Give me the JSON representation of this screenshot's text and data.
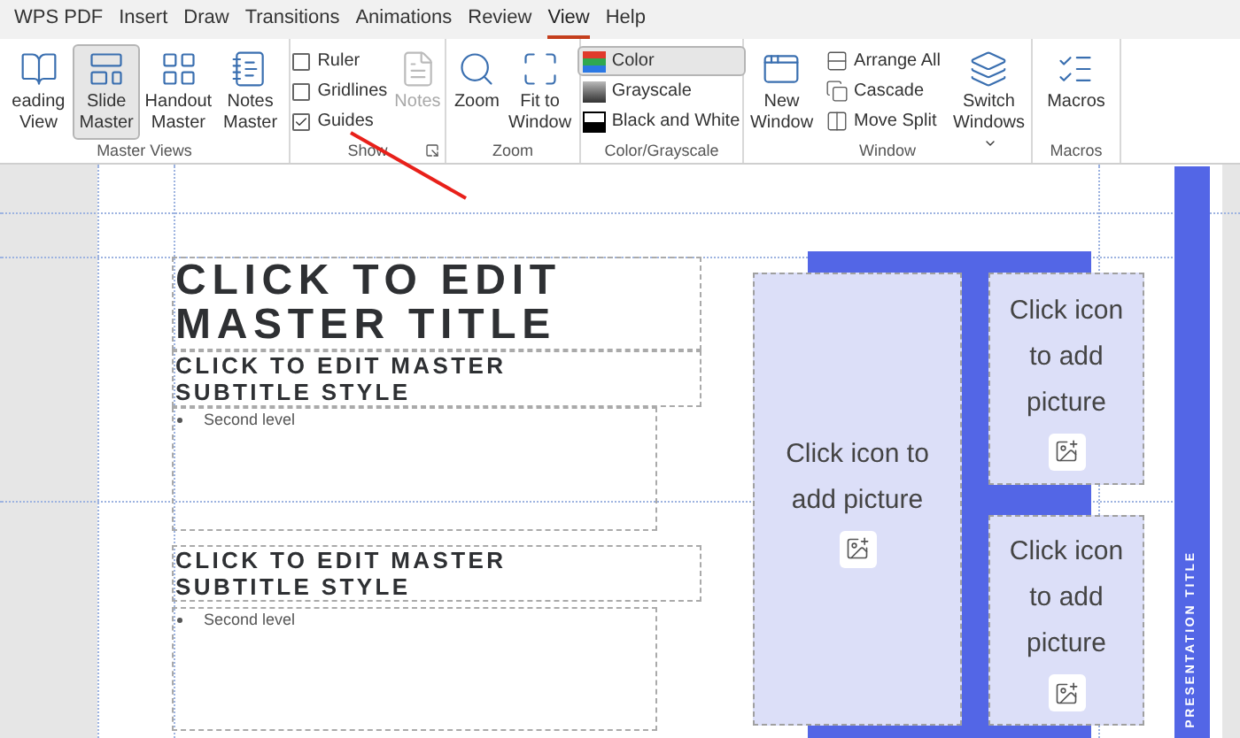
{
  "tabs": [
    {
      "label": "WPS PDF",
      "selected": false
    },
    {
      "label": "Insert",
      "selected": false
    },
    {
      "label": "Draw",
      "selected": false
    },
    {
      "label": "Transitions",
      "selected": false
    },
    {
      "label": "Animations",
      "selected": false
    },
    {
      "label": "Review",
      "selected": false
    },
    {
      "label": "View",
      "selected": true
    },
    {
      "label": "Help",
      "selected": false
    }
  ],
  "ribbon": {
    "groups": [
      {
        "label": "Master Views",
        "items": [
          {
            "kind": "large",
            "label": "eading View",
            "selected": false,
            "disabled": false
          },
          {
            "kind": "large",
            "label": "Slide Master",
            "selected": true,
            "disabled": false
          },
          {
            "kind": "large",
            "label": "Handout Master",
            "selected": false,
            "disabled": false
          },
          {
            "kind": "large",
            "label": "Notes Master",
            "selected": false,
            "disabled": false
          }
        ]
      },
      {
        "label": "Show",
        "launcher": true,
        "items": [
          {
            "kind": "check",
            "label": "Ruler",
            "checked": false
          },
          {
            "kind": "check",
            "label": "Gridlines",
            "checked": false
          },
          {
            "kind": "check",
            "label": "Guides",
            "checked": true
          },
          {
            "kind": "large",
            "label": "Notes",
            "selected": false,
            "disabled": true
          }
        ]
      },
      {
        "label": "Zoom",
        "items": [
          {
            "kind": "large",
            "label": "Zoom",
            "selected": false,
            "disabled": false
          },
          {
            "kind": "large",
            "label": "Fit to Window",
            "selected": false,
            "disabled": false
          }
        ]
      },
      {
        "label": "Color/Grayscale",
        "items": [
          {
            "kind": "small",
            "label": "Color",
            "selected": true
          },
          {
            "kind": "small",
            "label": "Grayscale",
            "selected": false
          },
          {
            "kind": "small",
            "label": "Black and White",
            "selected": false
          }
        ]
      },
      {
        "label": "Window",
        "items": [
          {
            "kind": "large",
            "label": "New Window",
            "selected": false,
            "disabled": false
          },
          {
            "kind": "small",
            "label": "Arrange All",
            "selected": false
          },
          {
            "kind": "small",
            "label": "Cascade",
            "selected": false
          },
          {
            "kind": "small",
            "label": "Move Split",
            "selected": false
          },
          {
            "kind": "menu-large",
            "label": "Switch Windows",
            "selected": false,
            "disabled": false
          }
        ]
      },
      {
        "label": "Macros",
        "items": [
          {
            "kind": "large",
            "label": "Macros",
            "selected": false,
            "disabled": false
          }
        ]
      }
    ]
  },
  "slide": {
    "title": "CLICK TO EDIT MASTER TITLE",
    "sections": [
      {
        "subtitle": "CLICK TO EDIT MASTER SUBTITLE STYLE",
        "bullet": "Second level"
      },
      {
        "subtitle": "CLICK TO EDIT MASTER SUBTITLE STYLE",
        "bullet": "Second level"
      }
    ],
    "picture_placeholders": [
      "Click icon to add picture",
      "Click icon to add picture",
      "Click icon to add picture"
    ],
    "side_title": "PRESENTATION TITLE"
  }
}
